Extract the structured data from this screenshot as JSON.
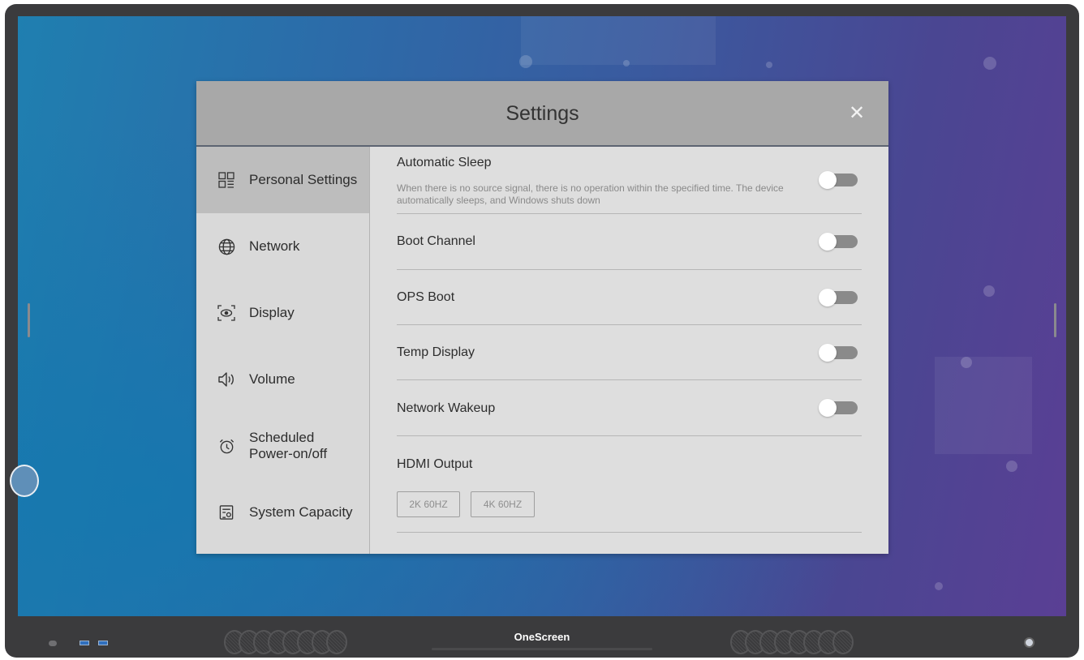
{
  "device": {
    "brand": "OneScreen"
  },
  "dialog": {
    "title": "Settings",
    "close_icon": "close-icon"
  },
  "nav": {
    "items": [
      {
        "label": "Personal Settings",
        "icon": "grid-icon",
        "active": true
      },
      {
        "label": "Network",
        "icon": "globe-icon",
        "active": false
      },
      {
        "label": "Display",
        "icon": "eye-scan-icon",
        "active": false
      },
      {
        "label": "Volume",
        "icon": "speaker-icon",
        "active": false
      },
      {
        "label": "Scheduled Power-on/off",
        "line1": "Scheduled",
        "line2": "Power-on/off",
        "icon": "alarm-clock-icon",
        "active": false
      },
      {
        "label": "System Capacity",
        "icon": "storage-icon",
        "active": false
      }
    ]
  },
  "settings": {
    "automatic_sleep": {
      "title": "Automatic Sleep",
      "description": "When there is no source signal, there is no operation within the specified time. The device automatically sleeps, and Windows shuts down",
      "enabled": false
    },
    "boot_channel": {
      "title": "Boot Channel",
      "enabled": false
    },
    "ops_boot": {
      "title": "OPS Boot",
      "enabled": false
    },
    "temp_display": {
      "title": "Temp Display",
      "enabled": false
    },
    "network_wakeup": {
      "title": "Network Wakeup",
      "enabled": false
    },
    "hdmi_output": {
      "title": "HDMI Output",
      "options": [
        "2K 60HZ",
        "4K 60HZ"
      ]
    }
  },
  "colors": {
    "header": "#a8a8a8",
    "dialog_bg": "#dedede",
    "active_nav": "#bdbdbd",
    "toggle_off_track": "#8a8a8a"
  }
}
